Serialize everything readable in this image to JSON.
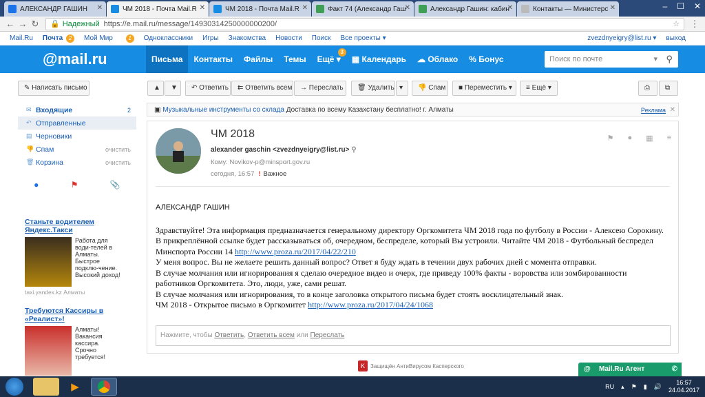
{
  "tabs": [
    {
      "title": "АЛЕКСАНДР ГАШИН",
      "color": "#1a73e8"
    },
    {
      "title": "ЧМ 2018 - Почта Mail.R",
      "color": "#168de2",
      "active": true
    },
    {
      "title": "ЧМ 2018 - Почта Mail.R",
      "color": "#168de2"
    },
    {
      "title": "Факт 74 (Александр Гаш",
      "color": "#3fa055"
    },
    {
      "title": "Александр Гашин: кабин",
      "color": "#3fa055"
    },
    {
      "title": "Контакты — Министерс",
      "color": "#888888"
    }
  ],
  "address": {
    "secure_label": "Надежный",
    "url": "https://e.mail.ru/message/14930314250000000200/"
  },
  "portal": {
    "items": [
      "Mail.Ru",
      "Почта",
      "Мой Мир",
      "Одноклассники",
      "Игры",
      "Знакомства",
      "Новости",
      "Поиск",
      "Все проекты ▾"
    ],
    "mail_badge": "2",
    "mymir_badge": "1",
    "user": "zvezdnyeigry@list.ru ▾",
    "logout": "выход"
  },
  "header": {
    "logo": "@mail.ru",
    "nav": [
      "Письма",
      "Контакты",
      "Файлы",
      "Темы",
      "Ещё"
    ],
    "more_badge": "3",
    "calendar": "Календарь",
    "cloud": "Облако",
    "bonus": "Бонус",
    "search_placeholder": "Поиск по почте"
  },
  "toolbar": {
    "compose": "Написать письмо",
    "reply": "Ответить",
    "reply_all": "Ответить всем",
    "forward": "Переслать",
    "delete": "Удалить",
    "spam": "Спам",
    "move": "Переместить",
    "more": "Ещё"
  },
  "folders": [
    {
      "label": "Входящие",
      "count": "2",
      "icon": "inbox-icon"
    },
    {
      "label": "Отправленные",
      "icon": "sent-icon",
      "selected": true
    },
    {
      "label": "Черновики",
      "icon": "drafts-icon"
    },
    {
      "label": "Спам",
      "action": "очистить",
      "icon": "spam-icon"
    },
    {
      "label": "Корзина",
      "action": "очистить",
      "icon": "trash-icon"
    }
  ],
  "ads": [
    {
      "title": "Станьте водителем Яндекс.Такси",
      "text": "Работа для води-телей в Алматы. Быстрое подклю-чение. Высокий доход!",
      "foot": "taxi.yandex.kz   Алматы"
    },
    {
      "title": "Требуются Кассиры в «Реалист»!",
      "text": "Алматы! Вакансия кассира. Срочно требуется!"
    }
  ],
  "promo": {
    "link": "Музыкальные инструменты со склада",
    "text": " Доставка по всему Казахстану бесплатно! г. Алматы",
    "ad_label": "Реклама"
  },
  "message": {
    "subject": "ЧМ 2018",
    "from": "alexander gaschin <zvezdnyeigry@list.ru>",
    "to": "Кому: Novikov-p@minsport.gov.ru",
    "date": "сегодня, 16:57",
    "important": "Важное",
    "signature": "АЛЕКСАНДР ГАШИН",
    "p1": "Здравствуйте! Эта информация предназначается генеральному директору Оргкомитета ЧМ 2018 года по футболу в России - Алексею Сорокину. В прикреплённой ссылке будет рассказываться об, очередном, беспределе, который Вы устроили. Читайте ЧМ 2018 - Футбольный беспредел Минспорта России 14 ",
    "link1": "http://www.proza.ru/2017/04/22/210",
    "p2": "У меня вопрос. Вы не желаете решить данный вопрос? Ответ я буду ждать в течении двух рабочих дней с момента отправки.",
    "p3": "В случае молчания или игнорирования я сделаю очередное видео и очерк, где приведу 100% факты - воровства или зомбированности работников Оргкомитета. Это, люди, уже, сами решат.",
    "p4": "В случае молчания или игнорирования, то в конце заголовка открытого письма будет стоять восклицательный знак.",
    "p5": "ЧМ 2018 - Открытое письмо в Оргкомитет ",
    "link2": "http://www.proza.ru/2017/04/24/1068 "
  },
  "reply_box": {
    "prefix": "Нажмите, чтобы ",
    "reply": "Ответить",
    "sep1": ", ",
    "reply_all": "Ответить всем",
    "or": " или ",
    "forward": "Переслать"
  },
  "footer": {
    "kaspersky": "Защищён АнтиВирусом Касперского",
    "agent": "Mail.Ru Агент"
  },
  "taskbar": {
    "lang": "RU",
    "time": "16:57",
    "date": "24.04.2017"
  }
}
